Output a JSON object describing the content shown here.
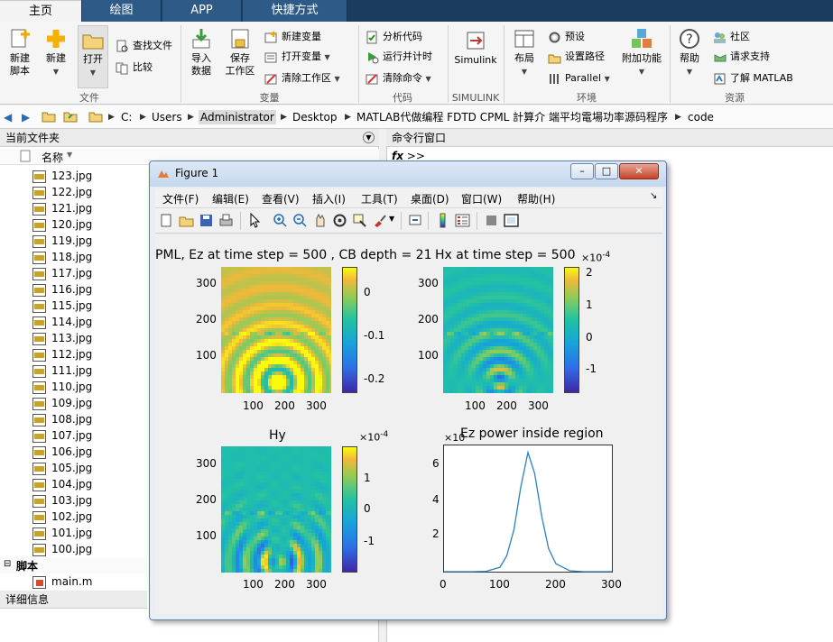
{
  "tabs": [
    {
      "label": "主页"
    },
    {
      "label": "绘图"
    },
    {
      "label": "APP"
    },
    {
      "label": "快捷方式"
    }
  ],
  "ribbon": {
    "file_group": {
      "title": "文件",
      "new_script": "新建\n脚本",
      "new": "新建",
      "open": "打开",
      "find_files": "查找文件",
      "compare": "比较"
    },
    "variable_group": {
      "title": "变量",
      "import_data": "导入\n数据",
      "save_workspace": "保存\n工作区",
      "new_variable": "新建变量",
      "open_variable": "打开变量",
      "clear_workspace": "清除工作区"
    },
    "code_group": {
      "title": "代码",
      "analyze_code": "分析代码",
      "run_and_time": "运行并计时",
      "clear_commands": "清除命令"
    },
    "simulink_group": {
      "title": "SIMULINK",
      "simulink": "Simulink"
    },
    "env_group": {
      "title": "环境",
      "layout": "布局",
      "preferences": "预设",
      "set_path": "设置路径",
      "parallel": "Parallel",
      "addons": "附加功能"
    },
    "resources_group": {
      "title": "资源",
      "help": "帮助",
      "community": "社区",
      "request_support": "请求支持",
      "learn_matlab": "了解 MATLAB"
    }
  },
  "address": {
    "crumbs": [
      "C:",
      "Users",
      "Administrator",
      "Desktop",
      "MATLAB代做编程 FDTD CPML 計算介 端平均電場功率源码程序",
      "code"
    ]
  },
  "file_panel": {
    "title": "当前文件夹",
    "name_col": "名称",
    "files": [
      "123.jpg",
      "122.jpg",
      "121.jpg",
      "120.jpg",
      "119.jpg",
      "118.jpg",
      "117.jpg",
      "116.jpg",
      "115.jpg",
      "114.jpg",
      "113.jpg",
      "112.jpg",
      "111.jpg",
      "110.jpg",
      "109.jpg",
      "108.jpg",
      "107.jpg",
      "106.jpg",
      "105.jpg",
      "104.jpg",
      "103.jpg",
      "102.jpg",
      "101.jpg",
      "100.jpg"
    ],
    "script_section": "脚本",
    "script_file": "main.m",
    "details": "详细信息"
  },
  "command_window": {
    "title": "命令行窗口",
    "prompt": ">>",
    "fx": "fx"
  },
  "figure": {
    "title": "Figure 1",
    "menu": [
      "文件(F)",
      "编辑(E)",
      "查看(V)",
      "插入(I)",
      "工具(T)",
      "桌面(D)",
      "窗口(W)",
      "帮助(H)"
    ],
    "plots": {
      "ez": {
        "title": "PML, Ez at time step = 500 , CB depth = 21",
        "y_ticks": [
          "300",
          "200",
          "100"
        ],
        "x_ticks": [
          "100",
          "200",
          "300"
        ],
        "cb_ticks": [
          "0",
          "-0.1",
          "-0.2"
        ]
      },
      "hx": {
        "title": "Hx at time step = 500",
        "y_ticks": [
          "300",
          "200",
          "100"
        ],
        "x_ticks": [
          "100",
          "200",
          "300"
        ],
        "cb_exp": "×10",
        "cb_exp_power": "-4",
        "cb_ticks": [
          "2",
          "1",
          "0",
          "-1"
        ]
      },
      "hy": {
        "title": "Hy",
        "y_ticks": [
          "300",
          "200",
          "100"
        ],
        "x_ticks": [
          "100",
          "200",
          "300"
        ],
        "cb_exp": "×10",
        "cb_exp_power": "-4",
        "cb_ticks": [
          "1",
          "0",
          "-1"
        ]
      },
      "power": {
        "title": "Ez power inside region",
        "y_exp": "×10",
        "y_ticks": [
          "6",
          "4",
          "2"
        ],
        "x_ticks": [
          "0",
          "100",
          "200",
          "300"
        ]
      }
    }
  },
  "colors": {
    "tabbar": "#1b3c5f",
    "line": "#2f7fc1",
    "parula_low": "#3e26a8",
    "parula_high": "#f9fb0e"
  },
  "chart_data": {
    "type": "line",
    "title": "Ez power inside region",
    "xlim": [
      0,
      300
    ],
    "x": [
      0,
      25,
      50,
      75,
      100,
      112,
      125,
      137,
      150,
      162,
      175,
      187,
      200,
      225,
      250,
      275,
      300
    ],
    "series": [
      {
        "values": [
          0,
          0,
          0,
          0.02,
          0.25,
          0.9,
          2.4,
          4.8,
          6.8,
          5.6,
          3.1,
          1.3,
          0.45,
          0.05,
          0,
          0,
          0
        ]
      }
    ]
  }
}
